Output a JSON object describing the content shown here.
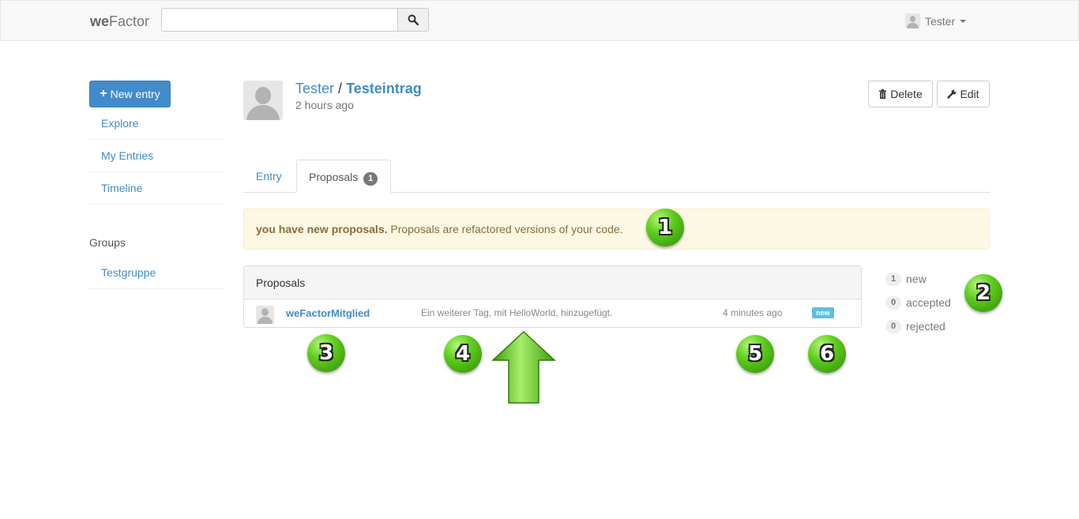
{
  "navbar": {
    "brand_bold": "we",
    "brand_rest": "Factor",
    "search": {
      "value": "",
      "placeholder": ""
    },
    "user_name": "Tester"
  },
  "sidebar": {
    "new_entry_label": "New entry",
    "items": [
      {
        "label": "Explore"
      },
      {
        "label": "My Entries"
      },
      {
        "label": "Timeline"
      }
    ],
    "groups_title": "Groups",
    "groups": [
      {
        "label": "Testgruppe"
      }
    ]
  },
  "entry": {
    "author": "Tester",
    "separator": "/",
    "title": "Testeintrag",
    "time": "2 hours ago",
    "delete_label": "Delete",
    "edit_label": "Edit"
  },
  "tabs": {
    "entry_label": "Entry",
    "proposals_label": "Proposals",
    "proposals_count": "1"
  },
  "alert": {
    "bold": "you have new proposals.",
    "text": " Proposals are refactored versions of your code."
  },
  "proposals": {
    "heading": "Proposals",
    "rows": [
      {
        "user": "weFactorMitglied",
        "description": "Ein weiterer Tag, mit HelloWorld, hinzugefügt.",
        "time": "4 minutes ago",
        "status": "new"
      }
    ]
  },
  "stats": [
    {
      "count": "1",
      "label": "new"
    },
    {
      "count": "0",
      "label": "accepted"
    },
    {
      "count": "0",
      "label": "rejected"
    }
  ],
  "callouts": [
    "1",
    "2",
    "3",
    "4",
    "5",
    "6"
  ],
  "colors": {
    "link": "#428bca",
    "primary_button": "#428bca",
    "alert_bg": "#fcf8e3",
    "alert_text": "#8a6d3b",
    "new_label": "#5bc0de",
    "callout_green": "#5ccc1c"
  },
  "icons": {
    "search": "search-icon",
    "plus": "plus-icon",
    "trash": "trash-icon",
    "wrench": "wrench-icon",
    "avatar": "user-silhouette-icon",
    "caret": "caret-down-icon",
    "arrow": "arrow-up-icon"
  }
}
